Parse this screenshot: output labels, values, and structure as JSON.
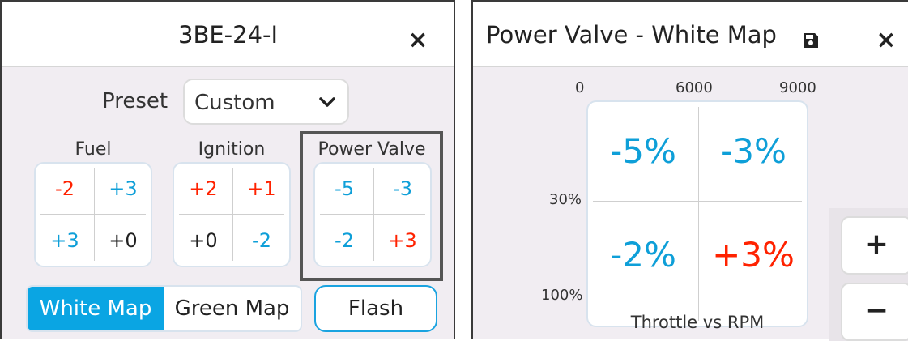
{
  "left": {
    "title": "3BE-24-I",
    "close_icon": "×",
    "preset": {
      "label": "Preset",
      "value": "Custom"
    },
    "fuel": {
      "label": "Fuel",
      "cells": [
        "-2",
        "+3",
        "+3",
        "+0"
      ]
    },
    "ignition": {
      "label": "Ignition",
      "cells": [
        "+2",
        "+1",
        "+0",
        "-2"
      ]
    },
    "power_valve": {
      "label": "Power Valve",
      "cells": [
        "-5",
        "-3",
        "-2",
        "+3"
      ]
    },
    "map_toggle": {
      "active": "White Map",
      "inactive": "Green Map"
    },
    "flash_label": "Flash"
  },
  "right": {
    "title": "Power Valve - White Map",
    "close_icon": "×",
    "x_ticks": [
      "0",
      "6000",
      "9000"
    ],
    "y_ticks": [
      "30%",
      "100%"
    ],
    "cells": [
      "-5%",
      "-3%",
      "-2%",
      "+3%"
    ],
    "caption": "Throttle vs RPM",
    "zoom_in": "+",
    "zoom_out": "−"
  },
  "colors": {
    "accent": "#0aa5e3",
    "negative": "#ff2200",
    "positive": "#0e9fd8",
    "panel_bg": "#f1edf2"
  },
  "icons": [
    "close-icon",
    "chevron-down-icon",
    "save-icon"
  ]
}
